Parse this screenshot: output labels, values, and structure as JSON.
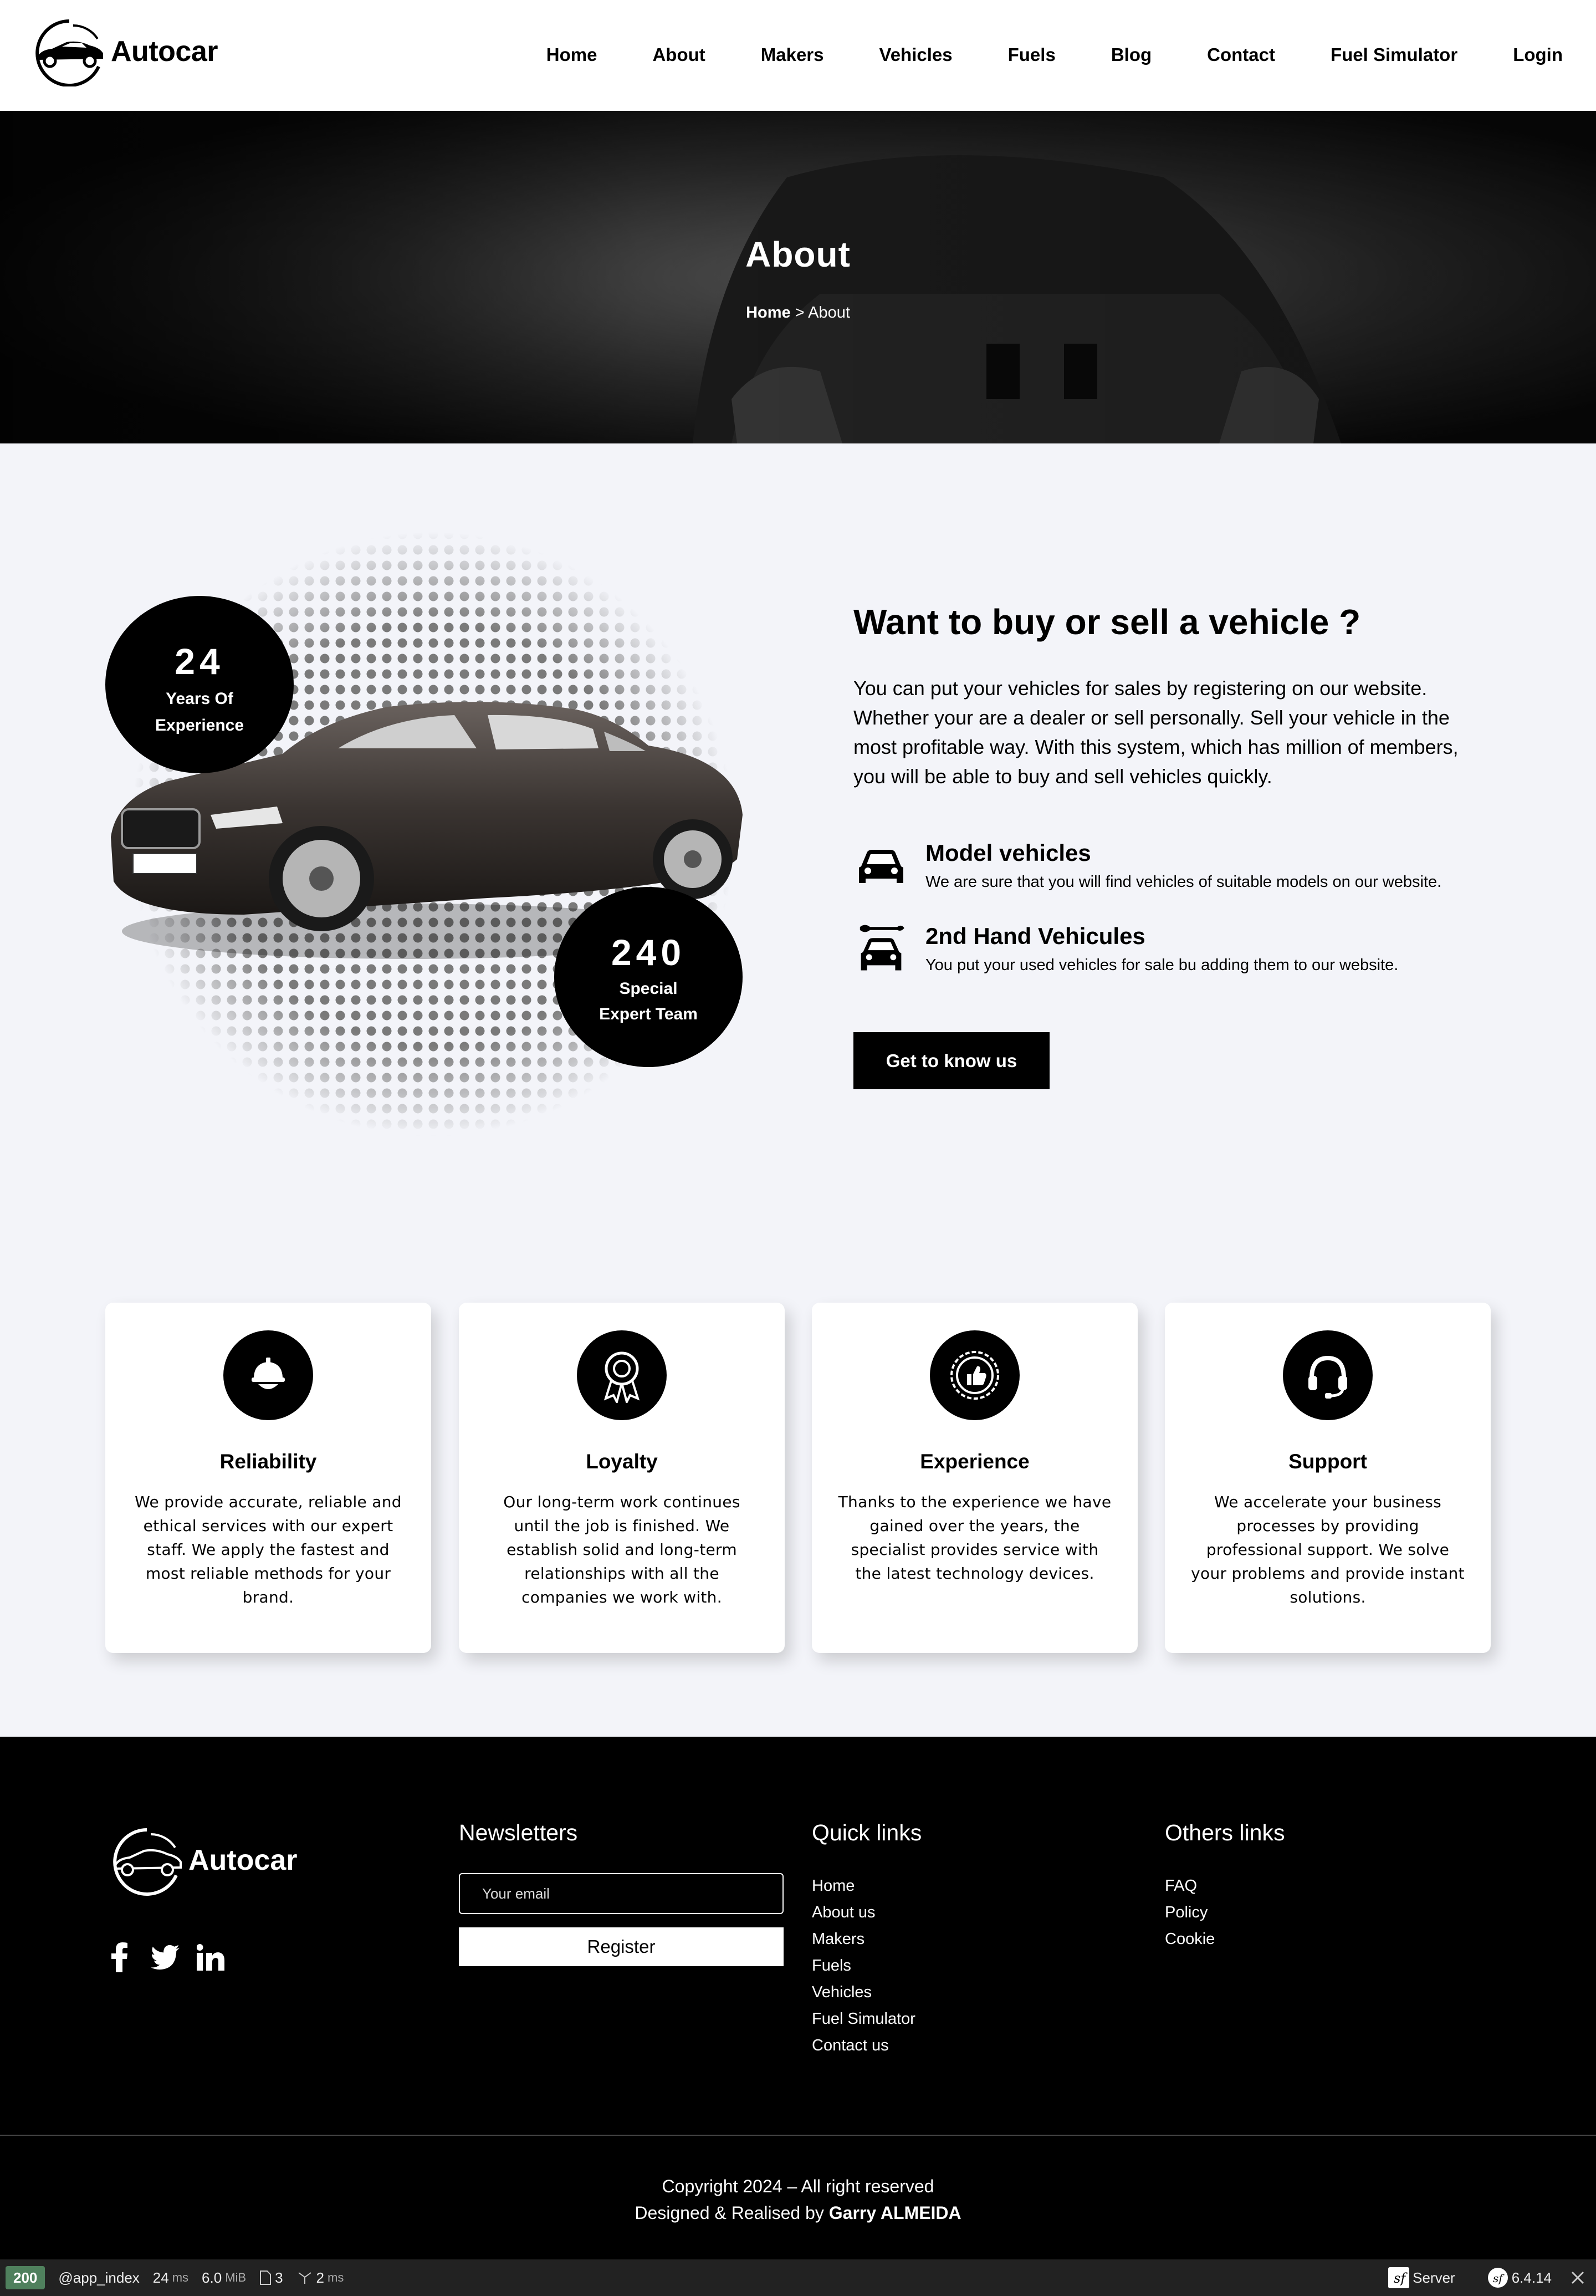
{
  "brand": {
    "name": "Autocar"
  },
  "nav": [
    "Home",
    "About",
    "Makers",
    "Vehicles",
    "Fuels",
    "Blog",
    "Contact",
    "Fuel Simulator",
    "Login"
  ],
  "hero": {
    "title": "About",
    "crumb_home": "Home",
    "crumb_sep": ">",
    "crumb_current": "About"
  },
  "about": {
    "stat1_num": "24",
    "stat1_label_1": "Years Of",
    "stat1_label_2": "Experience",
    "stat2_num": "240",
    "stat2_label_1": "Special",
    "stat2_label_2": "Expert Team",
    "title": "Want to buy or sell a vehicle ?",
    "text": "You can put your vehicles for sales by registering on our website. Whether your are a dealer or sell personally. Sell your vehicle in the most profitable way. With this system, which has million of members, you will be able to buy and sell vehicles quickly.",
    "feature1_title": "Model vehicles",
    "feature1_desc": "We are sure that you will find vehicles of suitable models on our website.",
    "feature2_title": "2nd Hand Vehicules",
    "feature2_desc": "You put your used vehicles for sale bu adding them to our website.",
    "button": "Get to know us"
  },
  "cards": [
    {
      "title": "Reliability",
      "text": "We provide accurate, reliable and ethical services with our expert staff. We apply the fastest and most reliable methods for your brand."
    },
    {
      "title": "Loyalty",
      "text": "Our long-term work continues until the job is finished. We establish solid and long-term relationships with all the companies we work with."
    },
    {
      "title": "Experience",
      "text": "Thanks to the experience we have gained over the years, the specialist provides service with the latest technology devices."
    },
    {
      "title": "Support",
      "text": "We accelerate your business processes by providing professional support. We solve your problems and provide instant solutions."
    }
  ],
  "footer": {
    "newsletter_title": "Newsletters",
    "email_placeholder": "Your email",
    "register": "Register",
    "quick_title": "Quick links",
    "quick_links": [
      "Home",
      "About us",
      "Makers",
      "Fuels",
      "Vehicles",
      "Fuel Simulator",
      "Contact us"
    ],
    "others_title": "Others links",
    "others_links": [
      "FAQ",
      "Policy",
      "Cookie"
    ],
    "copyright": "Copyright 2024 – All right reserved",
    "designed_prefix": "Designed & Realised by",
    "designer": "Garry ALMEIDA"
  },
  "toolbar": {
    "status": "200",
    "route": "@app_index",
    "time": "24",
    "time_unit": "ms",
    "memory": "6.0",
    "memory_unit": "MiB",
    "files": "3",
    "cache": "2",
    "cache_unit": "ms",
    "server": "Server",
    "version": "6.4.14"
  },
  "icons": [
    "car-logo-icon",
    "car-icon",
    "wrench-car-icon",
    "helmet-icon",
    "award-icon",
    "thumbs-up-badge-icon",
    "headset-icon",
    "facebook-icon",
    "twitter-icon",
    "linkedin-icon",
    "close-icon"
  ]
}
